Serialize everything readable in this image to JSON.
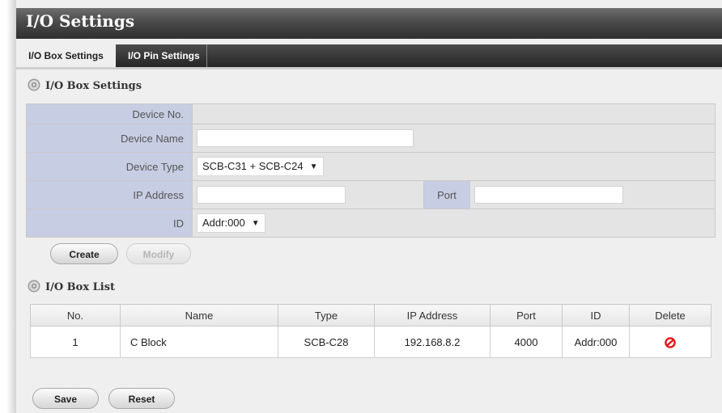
{
  "page": {
    "title": "I/O Settings"
  },
  "tabs": [
    {
      "label": "I/O Box Settings",
      "active": true
    },
    {
      "label": "I/O Pin Settings",
      "active": false
    }
  ],
  "box_settings": {
    "header": "I/O Box Settings",
    "device_no_label": "Device No.",
    "device_no_value": "",
    "device_name_label": "Device Name",
    "device_name_value": "",
    "device_type_label": "Device Type",
    "device_type_value": "SCB-C31 + SCB-C24",
    "ip_label": "IP Address",
    "ip_value": "",
    "port_label": "Port",
    "port_value": "",
    "id_label": "ID",
    "id_value": "Addr:000",
    "create_label": "Create",
    "modify_label": "Modify"
  },
  "box_list": {
    "header": "I/O Box List",
    "columns": [
      "No.",
      "Name",
      "Type",
      "IP Address",
      "Port",
      "ID",
      "Delete"
    ],
    "rows": [
      {
        "no": "1",
        "name": "C Block",
        "type": "SCB-C28",
        "ip": "192.168.8.2",
        "port": "4000",
        "id": "Addr:000"
      }
    ]
  },
  "footer": {
    "save_label": "Save",
    "reset_label": "Reset"
  },
  "colors": {
    "label_bg": "#c7cde2",
    "title_bar": "#3a3a3a",
    "delete_icon": "#e8161b"
  },
  "icons": {
    "section": "gear-icon",
    "delete": "delete-icon",
    "dropdown": "chevron-down-icon"
  }
}
